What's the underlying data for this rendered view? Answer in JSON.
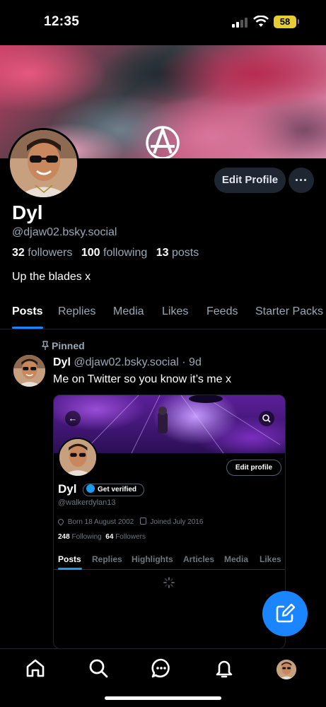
{
  "status_bar": {
    "time": "12:35",
    "battery": "58"
  },
  "profile": {
    "display_name": "Dyl",
    "handle": "@djaw02.bsky.social",
    "followers_count": "32",
    "followers_label": "followers",
    "following_count": "100",
    "following_label": "following",
    "posts_count": "13",
    "posts_label": "posts",
    "bio": "Up the blades x",
    "edit_profile_label": "Edit Profile",
    "more_label": "···"
  },
  "tabs": [
    {
      "label": "Posts",
      "active": true
    },
    {
      "label": "Replies"
    },
    {
      "label": "Media"
    },
    {
      "label": "Likes"
    },
    {
      "label": "Feeds"
    },
    {
      "label": "Starter Packs"
    }
  ],
  "post": {
    "pinned_label": "Pinned",
    "author": "Dyl",
    "handle": "@djaw02.bsky.social",
    "separator": "·",
    "age": "9d",
    "text": "Me on Twitter so you know it’s me x",
    "embed": {
      "edit_profile_label": "Edit profile",
      "name": "Dyl",
      "get_verified_label": "Get verified",
      "handle": "@walkerdylan13",
      "born": "Born 18 August 2002",
      "joined": "Joined July 2016",
      "following_count": "248",
      "following_label": "Following",
      "followers_count": "64",
      "followers_label": "Followers",
      "tabs": [
        "Posts",
        "Replies",
        "Highlights",
        "Articles",
        "Media",
        "Likes"
      ]
    }
  },
  "colors": {
    "accent": "#1a85ff",
    "button_bg": "#1e2731",
    "muted_text": "#9aa7b4"
  },
  "icons": {
    "nav": [
      "home-icon",
      "search-icon",
      "chat-icon",
      "bell-icon"
    ],
    "fab": "compose-icon",
    "banner_logo": "circle-a-logo"
  }
}
